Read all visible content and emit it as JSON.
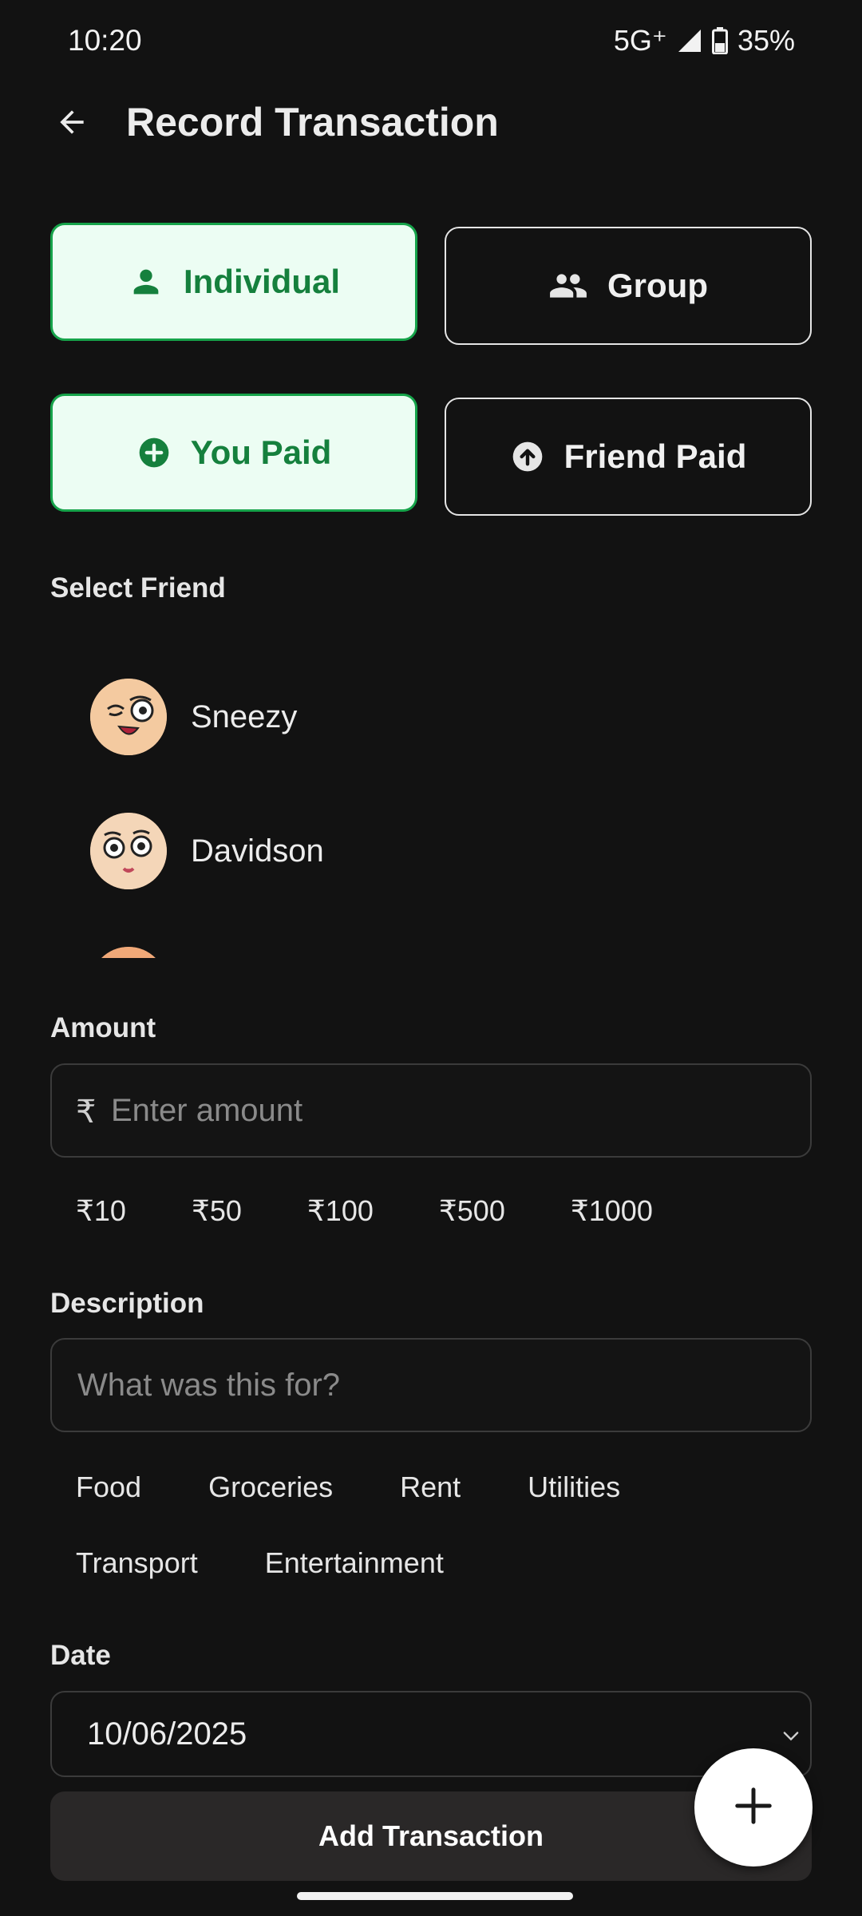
{
  "status_bar": {
    "time": "10:20",
    "network": "5G⁺",
    "battery": "35%"
  },
  "header": {
    "title": "Record Transaction"
  },
  "type_toggle": {
    "individual_label": "Individual",
    "group_label": "Group",
    "selected": "Individual"
  },
  "payer_toggle": {
    "you_paid_label": "You Paid",
    "friend_paid_label": "Friend Paid",
    "selected": "You Paid"
  },
  "friends": {
    "label": "Select Friend",
    "items": [
      {
        "name": "Sneezy"
      },
      {
        "name": "Davidson"
      }
    ]
  },
  "amount": {
    "label": "Amount",
    "currency_symbol": "₹",
    "placeholder": "Enter amount",
    "quick_values": [
      "₹10",
      "₹50",
      "₹100",
      "₹500",
      "₹1000"
    ]
  },
  "description": {
    "label": "Description",
    "placeholder": "What was this for?",
    "suggestions_row1": [
      "Food",
      "Groceries",
      "Rent",
      "Utilities"
    ],
    "suggestions_row2": [
      "Transport",
      "Entertainment"
    ]
  },
  "date": {
    "label": "Date",
    "value": "10/06/2025"
  },
  "actions": {
    "submit_label": "Add Transaction"
  },
  "colors": {
    "accent": "#15803d",
    "accent_bg": "#ecfdf3",
    "background": "#121212"
  },
  "icons": [
    "back-arrow-icon",
    "person-icon",
    "group-icon",
    "plus-circle-icon",
    "arrow-up-circle-icon",
    "chevron-down-icon",
    "plus-icon",
    "signal-icon",
    "battery-icon"
  ]
}
